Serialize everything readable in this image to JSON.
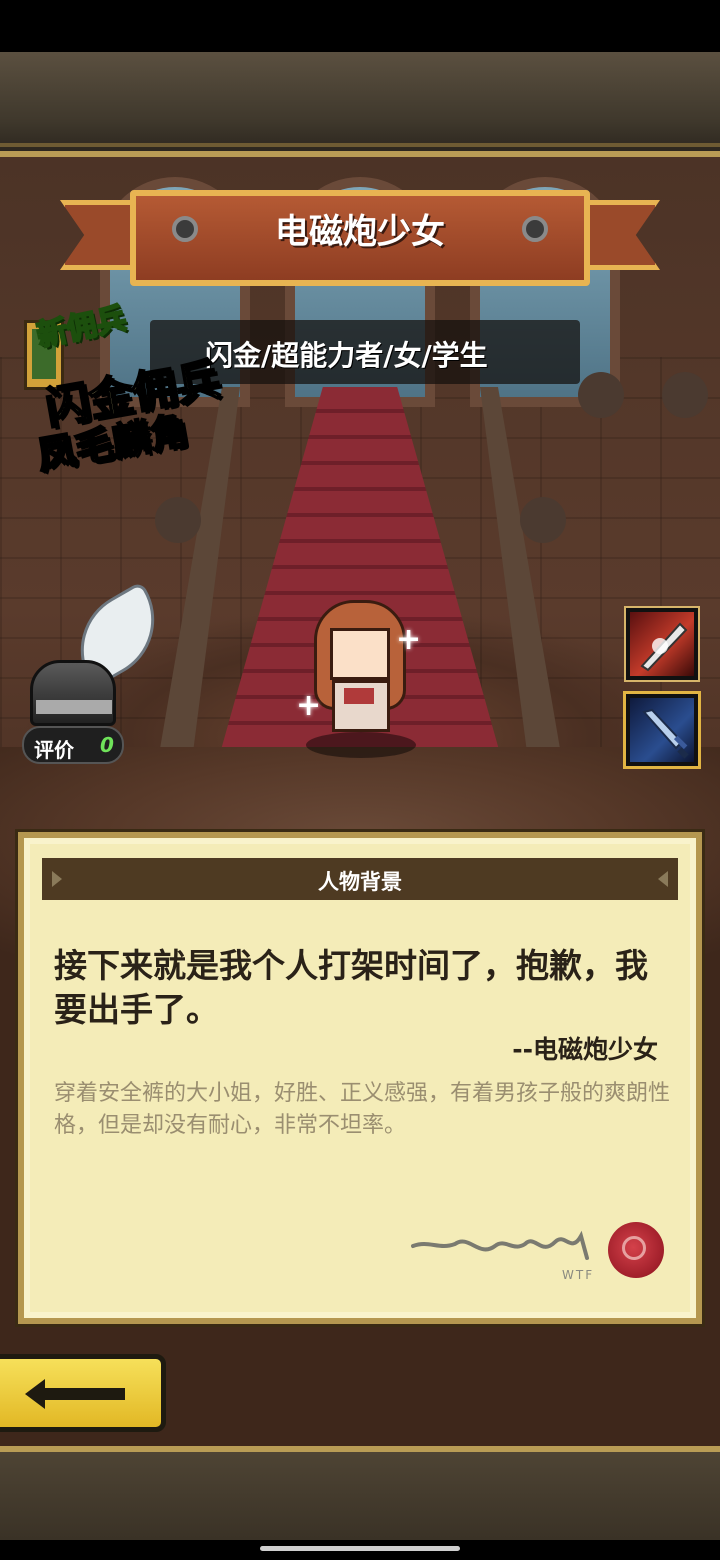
{
  "header": {
    "title": "电磁炮少女",
    "subtitle": "闪金/超能力者/女/学生"
  },
  "promo": {
    "badge_new": "新佣兵",
    "line1": "闪金佣兵",
    "line2": "凤毛麟角"
  },
  "rating": {
    "label": "评价",
    "value": "0"
  },
  "skills": [
    {
      "icon": "slash-skill-icon"
    },
    {
      "icon": "sword-skill-icon"
    }
  ],
  "background_panel": {
    "title": "人物背景",
    "quote": "接下来就是我个人打架时间了，抱歉，我要出手了。",
    "author": "--电磁炮少女",
    "description": "穿着安全裤的大小姐，好胜、正义感强，有着男孩子般的爽朗性格，但是却没有耐心，非常不坦率。",
    "signature_caption": "WTF"
  },
  "back_button": {
    "icon": "arrow-left-icon"
  },
  "colors": {
    "banner": "#9a4a2a",
    "banner_border": "#e8b452",
    "parchment": "#f4ecb8",
    "back_button": "#f6e05a",
    "rating_value": "#6fe35a"
  }
}
